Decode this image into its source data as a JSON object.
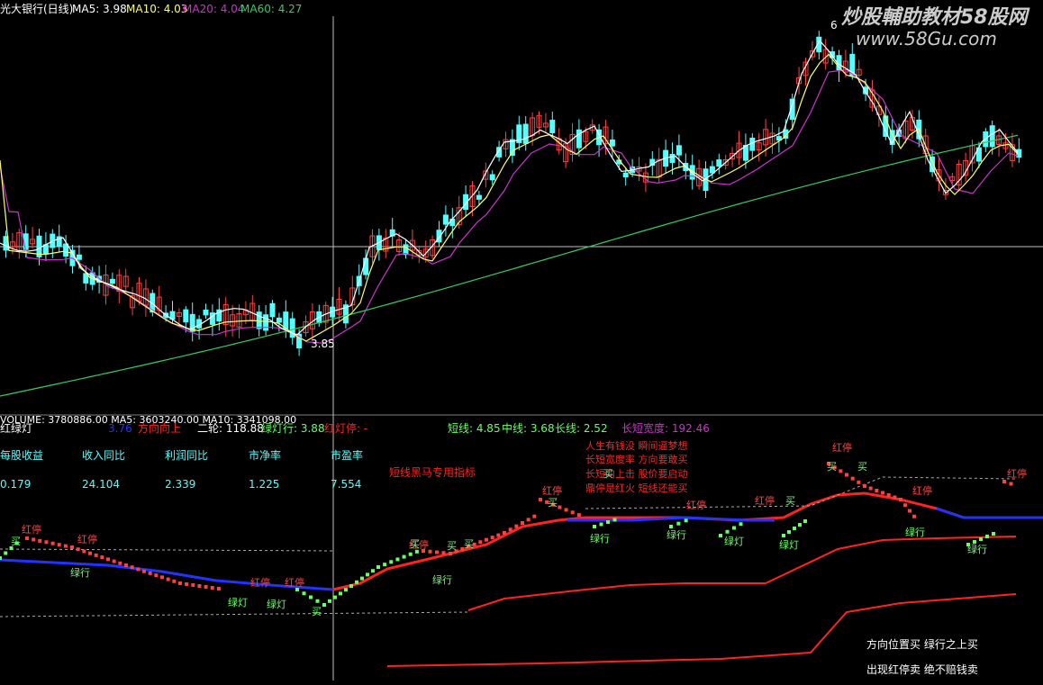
{
  "header": {
    "title": "光大银行(日线)",
    "ma5": "MA5: 3.98",
    "ma10": "MA10: 4.03",
    "ma20": "MA20: 4.04",
    "ma60": "MA60: 4.27"
  },
  "watermark": {
    "brand": "炒股輔助教材58股网",
    "url": "www.58Gu.com"
  },
  "price_panel": {
    "crosshair_price": "3.85",
    "high_label": "6"
  },
  "volume_bar": {
    "text": "VOLUME: 3780886.00  MA5: 3603240.00  MA10: 3341098.00"
  },
  "indicator_header": {
    "name": "红绿灯",
    "item1": "方向向上",
    "item1_val": "3.76",
    "item2": "二轮: 118.88",
    "item3": "绿灯行: 3.88",
    "item4": "红灯停: -",
    "short": "短线: 4.85",
    "mid": "中线: 3.68",
    "long": "长线: 2.52",
    "width": "长短宽度: 192.46"
  },
  "fundamentals": {
    "headers": [
      "每股收益",
      "收入同比",
      "利润同比",
      "市净率",
      "市盈率"
    ],
    "values": [
      "0.179",
      "24.104",
      "2.339",
      "1.225",
      "7.554"
    ]
  },
  "annotations": {
    "subtitle": "短线黑马专用指标",
    "notes": [
      "人生有钱没 瞬间逼梦想",
      "长短宽度率 方向要敢买",
      "长短向上击 股价要启动",
      "鼎停是红火 短线还能买"
    ],
    "footer1": "方向位置买 绿行之上买",
    "footer2": "出现红停卖 绝不赔钱卖",
    "signal_red": "红停",
    "signal_green_walk": "绿行",
    "signal_green_light": "绿灯",
    "signal_buy": "买"
  },
  "colors": {
    "up": "#ff4040",
    "down": "#54ffff",
    "ma5": "#ffffff",
    "ma10": "#ffff66",
    "ma20": "#cc33cc",
    "ma60": "#33cc66",
    "red_line": "#ff2222",
    "blue_line": "#2233ff",
    "green_dot": "#66ff66",
    "cyan": "#54ffff"
  },
  "chart_data": {
    "type": "line",
    "title": "光大银行(日线)",
    "series": [
      {
        "name": "MA5",
        "values": [
          3.98
        ]
      },
      {
        "name": "MA10",
        "values": [
          4.03
        ]
      },
      {
        "name": "MA20",
        "values": [
          4.04
        ]
      },
      {
        "name": "MA60",
        "values": [
          4.27
        ]
      }
    ],
    "annotations": [
      "3.85",
      "6"
    ]
  }
}
